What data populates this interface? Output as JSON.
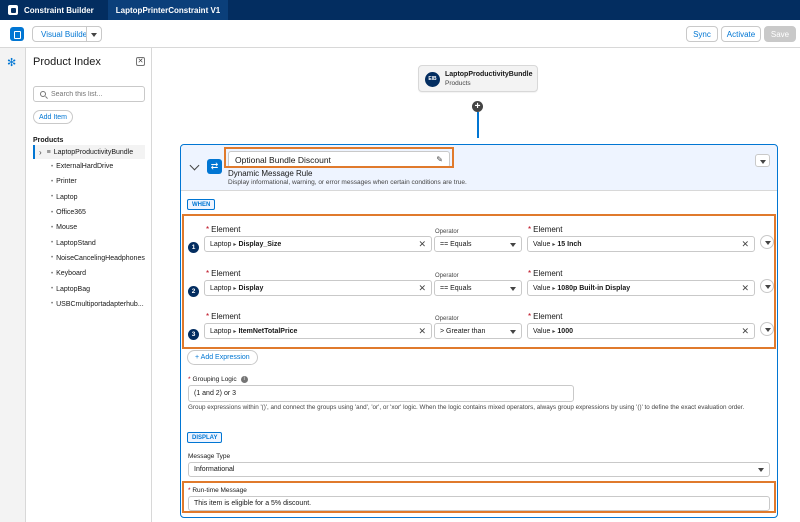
{
  "app": {
    "name": "Constraint Builder",
    "tab": "LaptopPrinterConstraint V1"
  },
  "toolbar": {
    "visual_builder": "Visual Builder",
    "sync": "Sync",
    "activate": "Activate",
    "save": "Save"
  },
  "sidebar": {
    "title": "Product Index",
    "close_glyph": "✕",
    "search_placeholder": "Search this list...",
    "add_item": "Add Item",
    "products_heading": "Products",
    "root": "LaptopProductivityBundle",
    "items": [
      "ExternalHardDrive",
      "Printer",
      "Laptop",
      "Office365",
      "Mouse",
      "LaptopStand",
      "NoiseCancelingHeadphones",
      "Keyboard",
      "LaptopBag",
      "USBCmultiportadapterhub..."
    ]
  },
  "canvas": {
    "bundle": {
      "icon_text": "EIB",
      "name": "LaptopProductivityBundle",
      "sub": "Products"
    },
    "plus_glyph": "+"
  },
  "rule": {
    "name": "Optional Bundle Discount",
    "type": "Dynamic Message Rule",
    "description": "Display informational, warning, or error messages when certain conditions are true.",
    "when_label": "WHEN",
    "element_label": "Element",
    "operator_label": "Operator",
    "required_mark": "*",
    "clear_glyph": "✕",
    "caret_glyph": "▸",
    "expressions": [
      {
        "num": "1",
        "left_obj": "Laptop",
        "left_attr": "Display_Size",
        "operator": "== Equals",
        "value_prefix": "Value",
        "value": "15 Inch"
      },
      {
        "num": "2",
        "left_obj": "Laptop",
        "left_attr": "Display",
        "operator": "== Equals",
        "value_prefix": "Value",
        "value": "1080p Built-in Display"
      },
      {
        "num": "3",
        "left_obj": "Laptop",
        "left_attr": "ItemNetTotalPrice",
        "operator": "> Greater than",
        "value_prefix": "Value",
        "value": "1000"
      }
    ],
    "add_expression": "+ Add Expression",
    "grouping_label": "Grouping Logic",
    "grouping_value": "(1 and 2) or 3",
    "grouping_help": "Group expressions within '()', and connect the groups using 'and', 'or', or 'xor' logic. When the logic contains mixed operators, always group expressions by using '()' to define the exact evaluation order.",
    "display_label": "DISPLAY",
    "message_type_label": "Message Type",
    "message_type_value": "Informational",
    "runtime_label": "Run-time Message",
    "runtime_value": "This item is eligible for a 5% discount."
  },
  "colors": {
    "brand": "#0176d3",
    "header": "#032d60",
    "highlight": "#e07a2c"
  }
}
